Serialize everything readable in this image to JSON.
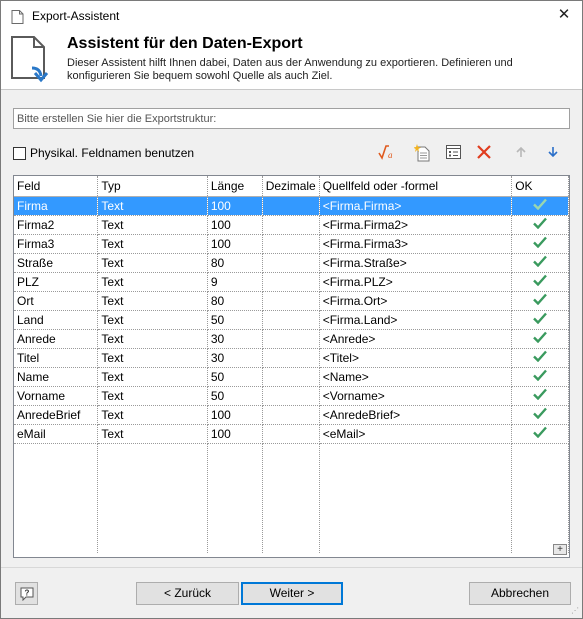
{
  "window": {
    "title": "Export-Assistent",
    "close_glyph": "✕"
  },
  "header": {
    "title": "Assistent für den Daten-Export",
    "description": "Dieser Assistent hilft Ihnen dabei, Daten aus der Anwendung zu exportieren. Definieren und konfigurieren Sie bequem sowohl Quelle als auch Ziel."
  },
  "structure": {
    "placeholder": "Bitte erstellen Sie hier die Exportstruktur:"
  },
  "options": {
    "physical_names_label": "Physikal. Feldnamen benutzen",
    "physical_names_checked": false
  },
  "toolbar": {
    "icons": [
      "formula-icon",
      "new-field-icon",
      "field-properties-icon",
      "delete-icon",
      "move-up-icon",
      "move-down-icon"
    ],
    "colors": {
      "formula": "#e05a1e",
      "delete": "#e03c1e",
      "arrow_disabled": "#b8b8b8",
      "arrow_enabled": "#2a6fc9"
    }
  },
  "grid": {
    "columns": [
      "Feld",
      "Typ",
      "Länge",
      "Dezimale",
      "Quellfeld oder -formel",
      "OK"
    ],
    "selected_row": 0,
    "ok_color": "#3a9a5e",
    "rows": [
      {
        "feld": "Firma",
        "typ": "Text",
        "laenge": "100",
        "dezimale": "",
        "quelle": "<Firma.Firma>",
        "ok": true
      },
      {
        "feld": "Firma2",
        "typ": "Text",
        "laenge": "100",
        "dezimale": "",
        "quelle": "<Firma.Firma2>",
        "ok": true
      },
      {
        "feld": "Firma3",
        "typ": "Text",
        "laenge": "100",
        "dezimale": "",
        "quelle": "<Firma.Firma3>",
        "ok": true
      },
      {
        "feld": "Straße",
        "typ": "Text",
        "laenge": "80",
        "dezimale": "",
        "quelle": "<Firma.Straße>",
        "ok": true
      },
      {
        "feld": "PLZ",
        "typ": "Text",
        "laenge": "9",
        "dezimale": "",
        "quelle": "<Firma.PLZ>",
        "ok": true
      },
      {
        "feld": "Ort",
        "typ": "Text",
        "laenge": "80",
        "dezimale": "",
        "quelle": "<Firma.Ort>",
        "ok": true
      },
      {
        "feld": "Land",
        "typ": "Text",
        "laenge": "50",
        "dezimale": "",
        "quelle": "<Firma.Land>",
        "ok": true
      },
      {
        "feld": "Anrede",
        "typ": "Text",
        "laenge": "30",
        "dezimale": "",
        "quelle": "<Anrede>",
        "ok": true
      },
      {
        "feld": "Titel",
        "typ": "Text",
        "laenge": "30",
        "dezimale": "",
        "quelle": "<Titel>",
        "ok": true
      },
      {
        "feld": "Name",
        "typ": "Text",
        "laenge": "50",
        "dezimale": "",
        "quelle": "<Name>",
        "ok": true
      },
      {
        "feld": "Vorname",
        "typ": "Text",
        "laenge": "50",
        "dezimale": "",
        "quelle": "<Vorname>",
        "ok": true
      },
      {
        "feld": "AnredeBrief",
        "typ": "Text",
        "laenge": "100",
        "dezimale": "",
        "quelle": "<AnredeBrief>",
        "ok": true
      },
      {
        "feld": "eMail",
        "typ": "Text",
        "laenge": "100",
        "dezimale": "",
        "quelle": "<eMail>",
        "ok": true
      }
    ]
  },
  "footer": {
    "back_label": "< Zurück",
    "next_label": "Weiter >",
    "cancel_label": "Abbrechen",
    "help_icon": "help-icon"
  }
}
